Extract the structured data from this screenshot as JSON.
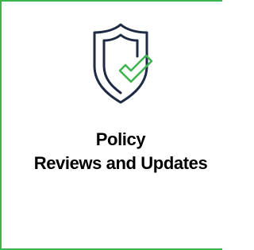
{
  "tile": {
    "icon": "shield-check-icon",
    "title_line1": "Policy",
    "title_line2": "Reviews and Updates",
    "colors": {
      "border": "#3fb34f",
      "icon_shield": "#1f2a44",
      "icon_check": "#3fb34f",
      "text": "#000000",
      "background": "#ffffff"
    }
  }
}
